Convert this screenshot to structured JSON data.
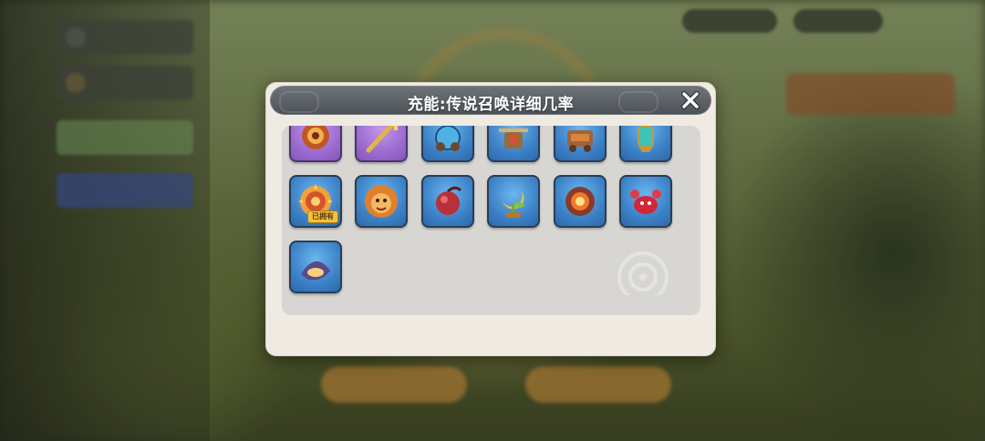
{
  "dialog": {
    "title": "充能:传说召唤详细几率",
    "close_icon": "close-icon"
  },
  "items": [
    {
      "name": "sun-emblem-icon",
      "bg": "purple"
    },
    {
      "name": "golden-trident-icon",
      "bg": "purple"
    },
    {
      "name": "blue-cannon-icon",
      "bg": "blue"
    },
    {
      "name": "crossbow-turret-icon",
      "bg": "blue"
    },
    {
      "name": "wooden-siege-cart-icon",
      "bg": "blue"
    },
    {
      "name": "teal-lantern-icon",
      "bg": "blue"
    },
    {
      "name": "sun-shield-icon",
      "bg": "blue",
      "badge": "已拥有"
    },
    {
      "name": "lion-mane-beast-icon",
      "bg": "blue"
    },
    {
      "name": "red-orb-seed-icon",
      "bg": "blue"
    },
    {
      "name": "golden-crescent-plant-icon",
      "bg": "blue"
    },
    {
      "name": "fiery-flower-icon",
      "bg": "blue"
    },
    {
      "name": "red-crab-creature-icon",
      "bg": "blue"
    },
    {
      "name": "purple-shell-icon",
      "bg": "blue"
    }
  ],
  "colors": {
    "panel": "#efebe2",
    "titlebar": "#55595e",
    "tile_blue": "#3c82c8",
    "tile_purple": "#9c6cd0",
    "badge": "#f3c23c"
  }
}
